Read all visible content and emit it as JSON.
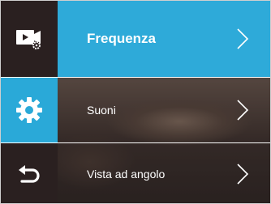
{
  "sidebar": {
    "items": [
      {
        "icon": "video-settings-icon"
      },
      {
        "icon": "gear-icon"
      },
      {
        "icon": "back-arrow-icon"
      }
    ]
  },
  "menu": {
    "items": [
      {
        "label": "Frequenza",
        "selected": true
      },
      {
        "label": "Suoni",
        "selected": false
      },
      {
        "label": "Vista ad angolo",
        "selected": false
      }
    ]
  },
  "colors": {
    "accent": "#2eaad9",
    "sidebar_bg": "#2a2020",
    "text": "#ffffff"
  }
}
